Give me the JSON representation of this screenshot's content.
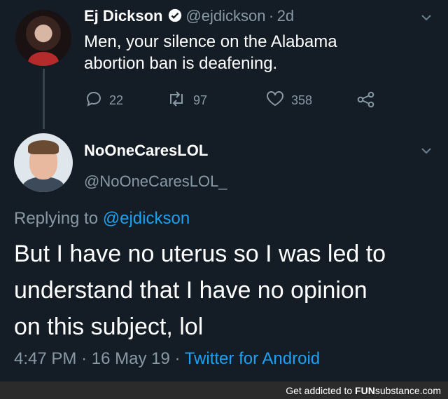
{
  "tweet1": {
    "name": "Ej Dickson",
    "handle": "@ejdickson",
    "sep": "·",
    "age": "2d",
    "text_line1": "Men, your silence on the Alabama",
    "text_line2": "abortion ban is deafening.",
    "replies": "22",
    "retweets": "97",
    "likes": "358"
  },
  "tweet2": {
    "name": "NoOneCaresLOL",
    "handle": "@NoOneCaresLOL_",
    "replying_prefix": "Replying to",
    "replying_handle": "@ejdickson",
    "text_line1": "But I have no uterus so I was led to",
    "text_line2": "understand that I have no opinion",
    "text_line3": "on this subject, lol",
    "time": "4:47 PM",
    "date": "16 May 19",
    "client": "Twitter for Android",
    "sep": "·"
  },
  "footer": {
    "prefix": "Get addicted to",
    "brand_bold": "FUN",
    "brand_rest": "substance.com"
  },
  "colors": {
    "background": "#141d26",
    "muted": "#8899a6",
    "link": "#1da1f2"
  }
}
